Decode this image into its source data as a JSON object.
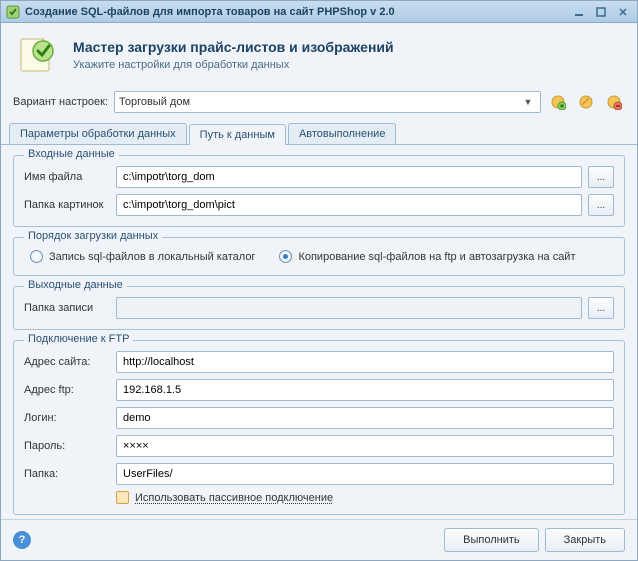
{
  "window": {
    "title": "Создание SQL-файлов для импорта товаров на сайт PHPShop v 2.0"
  },
  "header": {
    "title": "Мастер загрузки прайс-листов и изображений",
    "subtitle": "Укажите настройки для обработки данных"
  },
  "settings": {
    "label": "Вариант настроек:",
    "value": "Торговый дом"
  },
  "tabs": {
    "t0": "Параметры обработки данных",
    "t1": "Путь к данным",
    "t2": "Автовыполнение",
    "active": 1
  },
  "input_group": {
    "legend": "Входные данные",
    "file_label": "Имя файла",
    "file_value": "c:\\impotr\\torg_dom",
    "pic_label": "Папка картинок",
    "pic_value": "c:\\impotr\\torg_dom\\pict"
  },
  "order_group": {
    "legend": "Порядок загрузки данных",
    "opt1": "Запись sql-файлов в локальный каталог",
    "opt2": "Копирование sql-файлов на ftp и автозагрузка на сайт",
    "selected": 2
  },
  "output_group": {
    "legend": "Выходные данные",
    "folder_label": "Папка записи",
    "folder_value": ""
  },
  "ftp_group": {
    "legend": "Подключение к FTP",
    "site_label": "Адрес сайта:",
    "site_value": "http://localhost",
    "ftp_label": "Адрес ftp:",
    "ftp_value": "192.168.1.5",
    "login_label": "Логин:",
    "login_value": "demo",
    "pass_label": "Пароль:",
    "pass_value": "××××",
    "folder_label": "Папка:",
    "folder_value": "UserFiles/",
    "passive_label": "Использовать пассивное подключение"
  },
  "footer": {
    "run": "Выполнить",
    "close": "Закрыть"
  },
  "browse": "..."
}
